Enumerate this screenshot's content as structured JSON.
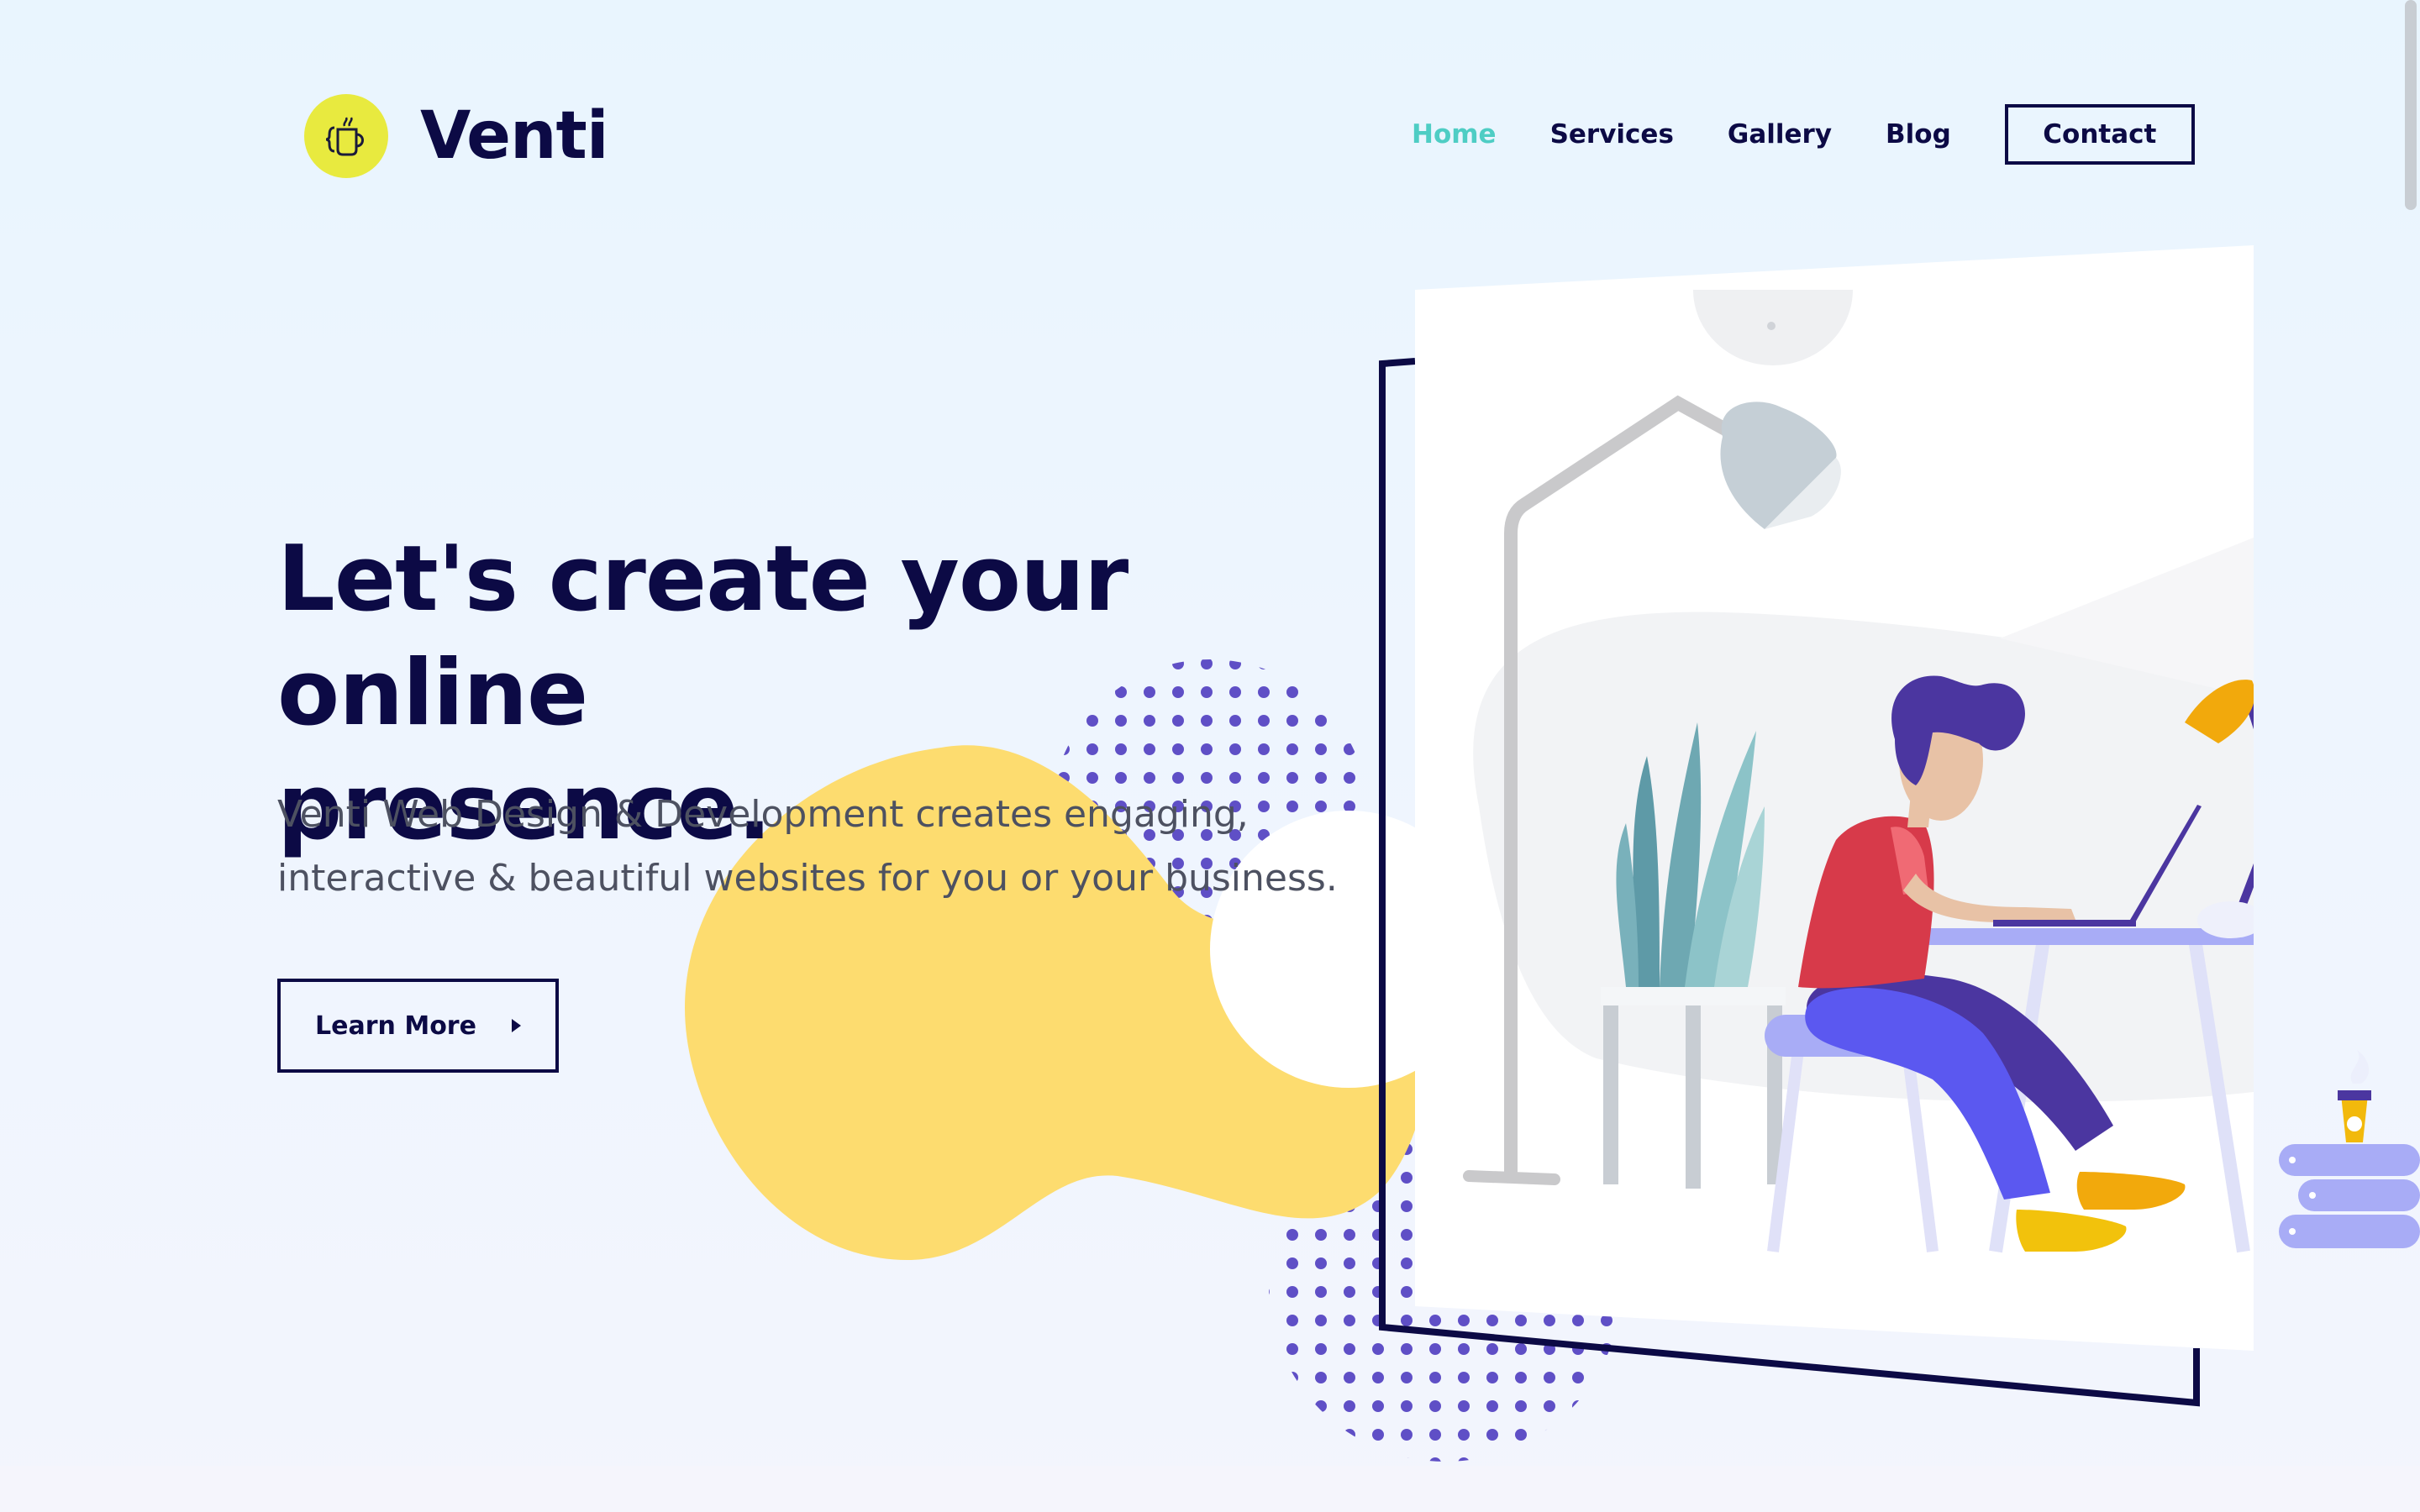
{
  "brand": {
    "name": "Venti",
    "logo_icon": "coffee-cup-braces-icon",
    "logo_color": "#e8ea3f"
  },
  "nav": {
    "items": [
      {
        "label": "Home",
        "active": true
      },
      {
        "label": "Services",
        "active": false
      },
      {
        "label": "Gallery",
        "active": false
      },
      {
        "label": "Blog",
        "active": false
      }
    ],
    "contact_label": "Contact",
    "active_color": "#4ecdc4"
  },
  "hero": {
    "title_line1": "Let's create your online",
    "title_line2": "presence.",
    "subtitle_line1": "Venti Web Design & Development creates engaging,",
    "subtitle_line2": "interactive & beautiful websites for you or your business.",
    "cta_label": "Learn More",
    "cta_icon": "caret-right-icon"
  },
  "illustration": {
    "subject": "person-working-at-laptop-illustration",
    "colors": {
      "blob": "#fddc6f",
      "dots": "#5f4fc6",
      "frame": "#0c0a45",
      "hair": "#4b36a0",
      "shirt": "#d73a4a",
      "pants": "#5b58f0",
      "shoes": "#f2b90c",
      "desk": "#a8acf6"
    }
  },
  "colors": {
    "text_primary": "#0c0a45",
    "text_secondary": "#4d5161",
    "background": "#eaf5fe"
  }
}
